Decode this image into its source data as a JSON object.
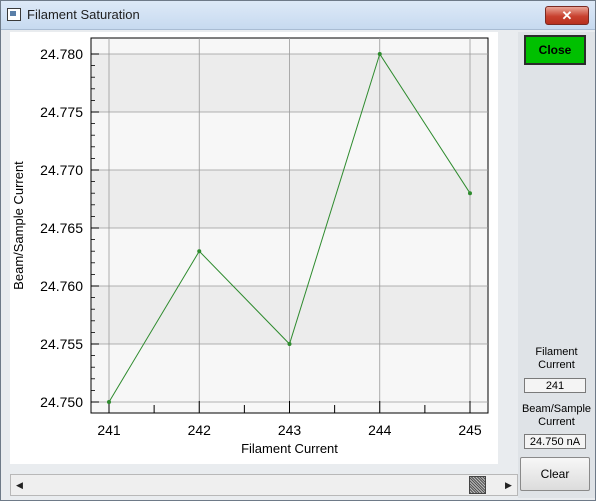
{
  "window": {
    "title": "Filament Saturation",
    "close_glyph": "✕",
    "icon": "app-window-icon"
  },
  "buttons": {
    "close_label": "Close",
    "clear_label": "Clear",
    "close_color": "#00c000"
  },
  "side": {
    "filament_label": "Filament Current",
    "filament_value": "241",
    "beam_label": "Beam/Sample Current",
    "beam_value": "24.750 nA"
  },
  "scrollbar": {
    "left_arrow": "◀",
    "right_arrow": "▶"
  },
  "chart_data": {
    "type": "line",
    "xlabel": "Filament Current",
    "ylabel": "Beam/Sample Current",
    "x": [
      241,
      242,
      243,
      244,
      245
    ],
    "y": [
      24.75,
      24.763,
      24.755,
      24.78,
      24.768
    ],
    "x_ticks": [
      "241",
      "242",
      "243",
      "244",
      "245"
    ],
    "y_ticks": [
      "24.750",
      "24.755",
      "24.760",
      "24.765",
      "24.770",
      "24.775",
      "24.780"
    ],
    "xlim": [
      241,
      245
    ],
    "ylim": [
      24.75,
      24.78
    ],
    "grid": true,
    "line_color": "#2e8b2e"
  }
}
